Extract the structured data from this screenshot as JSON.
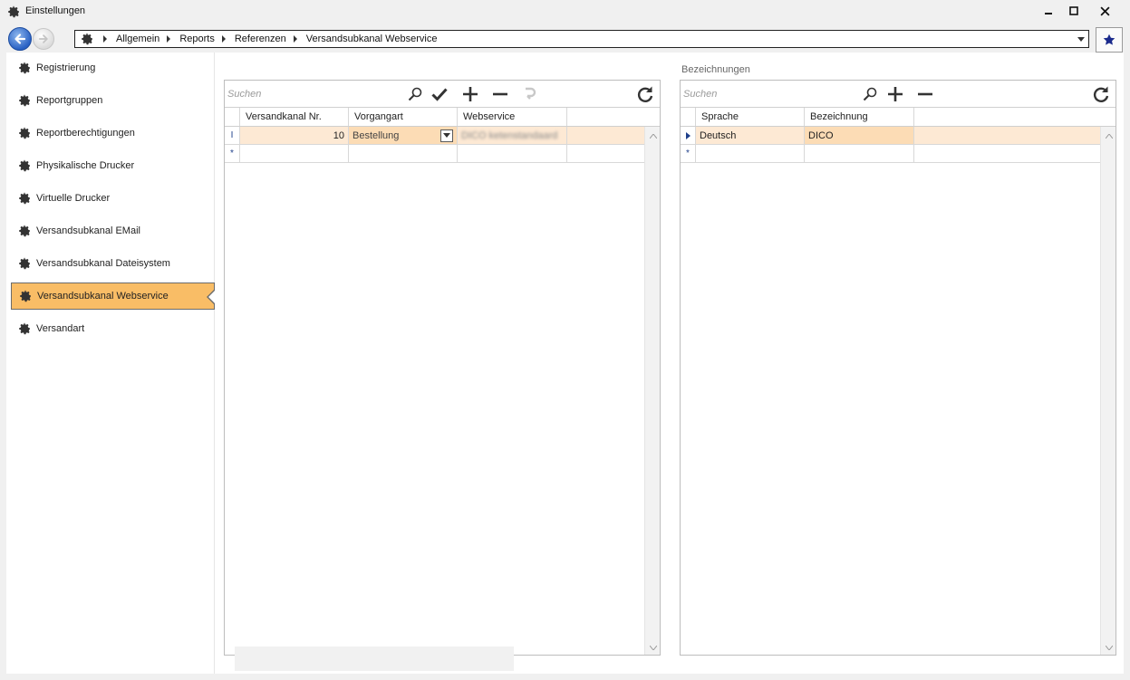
{
  "window": {
    "title": "Einstellungen",
    "controls": {
      "minimize": "minimize",
      "maximize": "maximize",
      "close": "close"
    }
  },
  "navigation": {
    "breadcrumb": [
      "Allgemein",
      "Reports",
      "Referenzen",
      "Versandsubkanal Webservice"
    ]
  },
  "sidebar": {
    "items": [
      {
        "label": "Registrierung",
        "icon": "gear-icon",
        "active": false
      },
      {
        "label": "Reportgruppen",
        "icon": "gear-icon",
        "active": false
      },
      {
        "label": "Reportberechtigungen",
        "icon": "gear-icon",
        "active": false
      },
      {
        "label": "Physikalische Drucker",
        "icon": "gear-icon",
        "active": false
      },
      {
        "label": "Virtuelle Drucker",
        "icon": "gear-icon",
        "active": false
      },
      {
        "label": "Versandsubkanal EMail",
        "icon": "gear-icon",
        "active": false
      },
      {
        "label": "Versandsubkanal Dateisystem",
        "icon": "gear-icon",
        "active": false
      },
      {
        "label": "Versandsubkanal Webservice",
        "icon": "gear-icon",
        "active": true
      },
      {
        "label": "Versandart",
        "icon": "gear-icon",
        "active": false
      }
    ],
    "active_color": "#f9bd66"
  },
  "left_panel": {
    "search_placeholder": "Suchen",
    "columns": [
      "Versandkanal Nr.",
      "Vorgangart",
      "Webservice"
    ],
    "rows": [
      {
        "indicator": "I",
        "versandkanal_nr": "10",
        "vorgangart": "Bestellung",
        "webservice": "DICO ketenstandaard"
      }
    ],
    "new_row_indicator": "*"
  },
  "right_panel": {
    "heading": "Bezeichnungen",
    "search_placeholder": "Suchen",
    "columns": [
      "Sprache",
      "Bezeichnung"
    ],
    "rows": [
      {
        "indicator": "▸",
        "sprache": "Deutsch",
        "bezeichnung": "DICO"
      }
    ],
    "new_row_indicator": "*"
  },
  "colors": {
    "selected_row": "#fde9d4",
    "editing_cell": "#fcdcb5",
    "accent_blue": "#1e3f8a"
  }
}
